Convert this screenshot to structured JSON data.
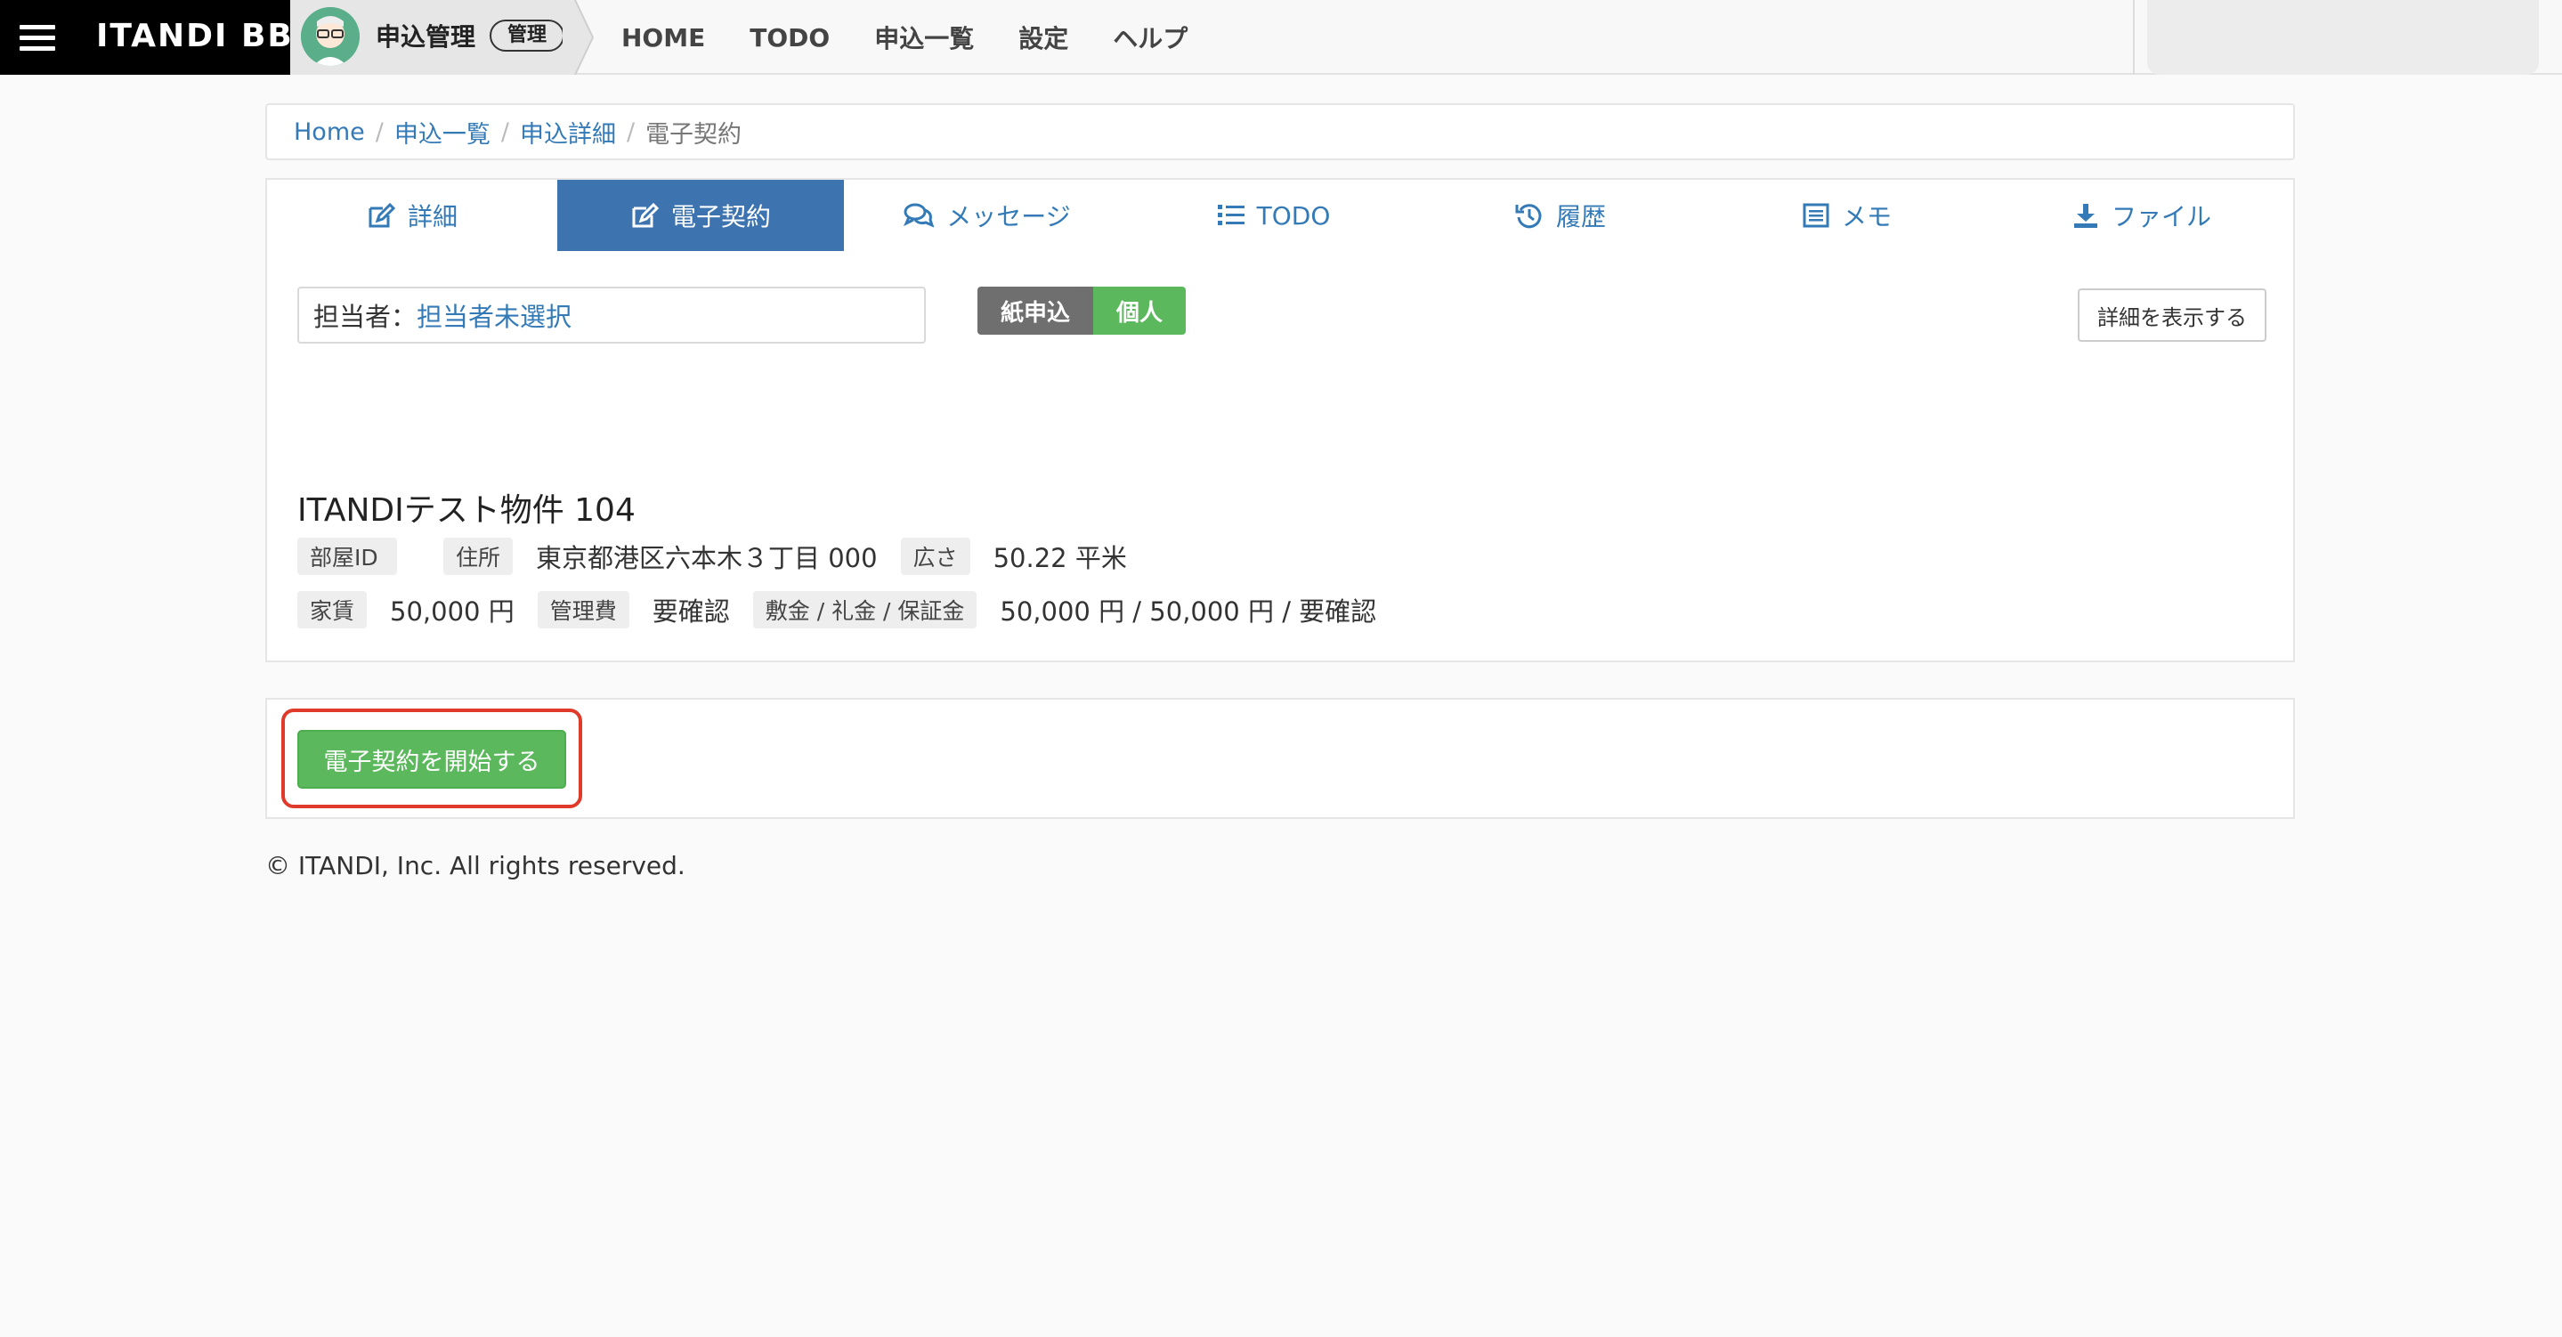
{
  "header": {
    "brand": "ITANDI BB",
    "app_title": "申込管理",
    "admin_badge": "管理",
    "nav": [
      "HOME",
      "TODO",
      "申込一覧",
      "設定",
      "ヘルプ"
    ]
  },
  "breadcrumb": {
    "items": [
      "Home",
      "申込一覧",
      "申込詳細"
    ],
    "current": "電子契約"
  },
  "tabs": [
    {
      "label": "詳細",
      "icon": "edit-icon",
      "active": false
    },
    {
      "label": "電子契約",
      "icon": "edit-icon",
      "active": true
    },
    {
      "label": "メッセージ",
      "icon": "comments-icon",
      "active": false
    },
    {
      "label": "TODO",
      "icon": "list-icon",
      "active": false
    },
    {
      "label": "履歴",
      "icon": "history-icon",
      "active": false
    },
    {
      "label": "メモ",
      "icon": "memo-icon",
      "active": false
    },
    {
      "label": "ファイル",
      "icon": "download-icon",
      "active": false
    }
  ],
  "assignee": {
    "label": "担当者：",
    "value": "担当者未選択"
  },
  "badges": {
    "paper": "紙申込",
    "personal": "個人"
  },
  "detail_button": "詳細を表示する",
  "property": {
    "name": "ITANDIテスト物件 104",
    "room_id_label": "部屋ID",
    "room_id_value": "",
    "address_label": "住所",
    "address_value": "東京都港区六本木３丁目 000",
    "area_label": "広さ",
    "area_value": "50.22 平米",
    "rent_label": "家賃",
    "rent_value": "50,000 円",
    "mgmt_label": "管理費",
    "mgmt_value": "要確認",
    "deposit_label": "敷金 / 礼金 / 保証金",
    "deposit_value": "50,000 円 / 50,000 円 / 要確認"
  },
  "action": {
    "start_label": "電子契約を開始する"
  },
  "footer": "© ITANDI, Inc. All rights reserved.",
  "colors": {
    "primary": "#337ab7",
    "active_tab": "#3d74b0",
    "success": "#5cb85c",
    "highlight": "#e03a2b"
  }
}
